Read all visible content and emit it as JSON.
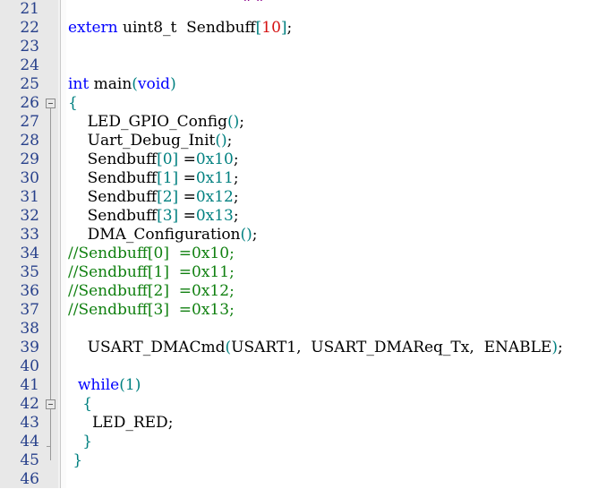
{
  "editor": {
    "name": "code-editor",
    "language": "C",
    "first_line_number": 21,
    "last_line_number": 46,
    "line_height_px": 21,
    "colors": {
      "background": "#ffffff",
      "gutter_background": "#e8e8e8",
      "line_number": "#27408b",
      "keyword": "#0000ff",
      "number": "#008080",
      "comment": "#108010",
      "literal_red": "#d41111",
      "punctuation": "#008080",
      "plain_text": "#000000",
      "fold_line": "#9a9a9a"
    },
    "clipped_top_fragment": "##"
  },
  "line_numbers": [
    "21",
    "22",
    "23",
    "24",
    "25",
    "26",
    "27",
    "28",
    "29",
    "30",
    "31",
    "32",
    "33",
    "34",
    "35",
    "36",
    "37",
    "38",
    "39",
    "40",
    "41",
    "42",
    "43",
    "44",
    "45",
    "46"
  ],
  "fold_markers": [
    {
      "line": "26",
      "type": "collapse-box",
      "state": "expanded"
    },
    {
      "line": "42",
      "type": "collapse-box",
      "state": "expanded"
    },
    {
      "line": "44",
      "type": "end-cap"
    }
  ],
  "lines": [
    {
      "number": "21",
      "tokens": []
    },
    {
      "number": "22",
      "tokens": [
        {
          "text": "extern",
          "cls": "t-kw"
        },
        {
          "text": " uint8_t  Sendbuff",
          "cls": "t-pln"
        },
        {
          "text": "[",
          "cls": "t-pun"
        },
        {
          "text": "10",
          "cls": "t-red"
        },
        {
          "text": "]",
          "cls": "t-pun"
        },
        {
          "text": ";",
          "cls": "t-pln"
        }
      ]
    },
    {
      "number": "23",
      "tokens": []
    },
    {
      "number": "24",
      "tokens": []
    },
    {
      "number": "25",
      "tokens": [
        {
          "text": "int",
          "cls": "t-kw"
        },
        {
          "text": " main",
          "cls": "t-pln"
        },
        {
          "text": "(",
          "cls": "t-pun"
        },
        {
          "text": "void",
          "cls": "t-kw"
        },
        {
          "text": ")",
          "cls": "t-pun"
        }
      ]
    },
    {
      "number": "26",
      "tokens": [
        {
          "text": "{",
          "cls": "t-pun"
        }
      ]
    },
    {
      "number": "27",
      "tokens": [
        {
          "text": "    LED_GPIO_Config",
          "cls": "t-pln"
        },
        {
          "text": "()",
          "cls": "t-pun"
        },
        {
          "text": ";",
          "cls": "t-pln"
        }
      ]
    },
    {
      "number": "28",
      "tokens": [
        {
          "text": "    Uart_Debug_Init",
          "cls": "t-pln"
        },
        {
          "text": "()",
          "cls": "t-pun"
        },
        {
          "text": ";",
          "cls": "t-pln"
        }
      ]
    },
    {
      "number": "29",
      "tokens": [
        {
          "text": "    Sendbuff",
          "cls": "t-pln"
        },
        {
          "text": "[",
          "cls": "t-pun"
        },
        {
          "text": "0",
          "cls": "t-num"
        },
        {
          "text": "]",
          "cls": "t-pun"
        },
        {
          "text": " =",
          "cls": "t-pln"
        },
        {
          "text": "0x10",
          "cls": "t-num"
        },
        {
          "text": ";",
          "cls": "t-pln"
        }
      ]
    },
    {
      "number": "30",
      "tokens": [
        {
          "text": "    Sendbuff",
          "cls": "t-pln"
        },
        {
          "text": "[",
          "cls": "t-pun"
        },
        {
          "text": "1",
          "cls": "t-num"
        },
        {
          "text": "]",
          "cls": "t-pun"
        },
        {
          "text": " =",
          "cls": "t-pln"
        },
        {
          "text": "0x11",
          "cls": "t-num"
        },
        {
          "text": ";",
          "cls": "t-pln"
        }
      ]
    },
    {
      "number": "31",
      "tokens": [
        {
          "text": "    Sendbuff",
          "cls": "t-pln"
        },
        {
          "text": "[",
          "cls": "t-pun"
        },
        {
          "text": "2",
          "cls": "t-num"
        },
        {
          "text": "]",
          "cls": "t-pun"
        },
        {
          "text": " =",
          "cls": "t-pln"
        },
        {
          "text": "0x12",
          "cls": "t-num"
        },
        {
          "text": ";",
          "cls": "t-pln"
        }
      ]
    },
    {
      "number": "32",
      "tokens": [
        {
          "text": "    Sendbuff",
          "cls": "t-pln"
        },
        {
          "text": "[",
          "cls": "t-pun"
        },
        {
          "text": "3",
          "cls": "t-num"
        },
        {
          "text": "]",
          "cls": "t-pun"
        },
        {
          "text": " =",
          "cls": "t-pln"
        },
        {
          "text": "0x13",
          "cls": "t-num"
        },
        {
          "text": ";",
          "cls": "t-pln"
        }
      ]
    },
    {
      "number": "33",
      "tokens": [
        {
          "text": "    DMA_Configuration",
          "cls": "t-pln"
        },
        {
          "text": "()",
          "cls": "t-pun"
        },
        {
          "text": ";",
          "cls": "t-pln"
        }
      ]
    },
    {
      "number": "34",
      "tokens": [
        {
          "text": "//Sendbuff[0]  =0x10;",
          "cls": "t-cmt"
        }
      ]
    },
    {
      "number": "35",
      "tokens": [
        {
          "text": "//Sendbuff[1]  =0x11;",
          "cls": "t-cmt"
        }
      ]
    },
    {
      "number": "36",
      "tokens": [
        {
          "text": "//Sendbuff[2]  =0x12;",
          "cls": "t-cmt"
        }
      ]
    },
    {
      "number": "37",
      "tokens": [
        {
          "text": "//Sendbuff[3]  =0x13;",
          "cls": "t-cmt"
        }
      ]
    },
    {
      "number": "38",
      "tokens": []
    },
    {
      "number": "39",
      "tokens": [
        {
          "text": "    USART_DMACmd",
          "cls": "t-pln"
        },
        {
          "text": "(",
          "cls": "t-pun"
        },
        {
          "text": "USART1,  USART_DMAReq_Tx,  ENABLE",
          "cls": "t-pln"
        },
        {
          "text": ")",
          "cls": "t-pun"
        },
        {
          "text": ";",
          "cls": "t-pln"
        }
      ]
    },
    {
      "number": "40",
      "tokens": []
    },
    {
      "number": "41",
      "tokens": [
        {
          "text": "  ",
          "cls": "t-pln"
        },
        {
          "text": "while",
          "cls": "t-kw"
        },
        {
          "text": "(",
          "cls": "t-pun"
        },
        {
          "text": "1",
          "cls": "t-num"
        },
        {
          "text": ")",
          "cls": "t-pun"
        }
      ]
    },
    {
      "number": "42",
      "tokens": [
        {
          "text": "   {",
          "cls": "t-pun"
        }
      ]
    },
    {
      "number": "43",
      "tokens": [
        {
          "text": "     LED_RED",
          "cls": "t-pln"
        },
        {
          "text": ";",
          "cls": "t-pln"
        }
      ]
    },
    {
      "number": "44",
      "tokens": [
        {
          "text": "   }",
          "cls": "t-pun"
        }
      ]
    },
    {
      "number": "45",
      "tokens": [
        {
          "text": " }",
          "cls": "t-pun"
        }
      ]
    },
    {
      "number": "46",
      "tokens": []
    }
  ]
}
